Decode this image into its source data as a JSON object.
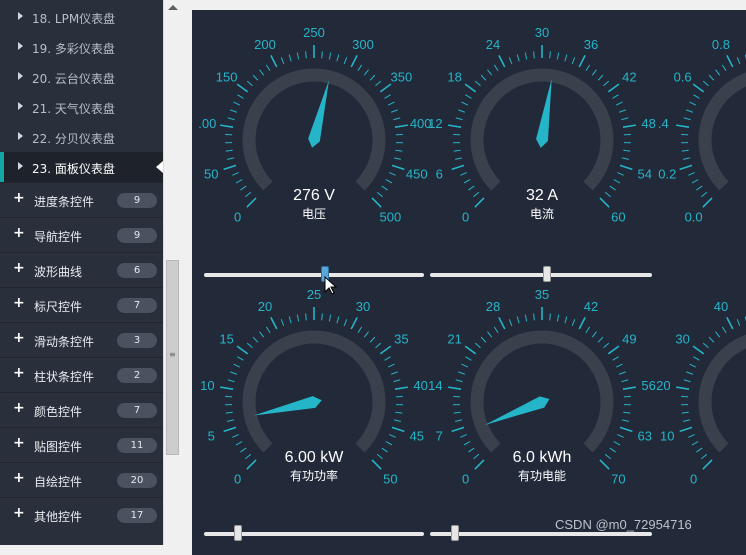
{
  "sidebar": {
    "sub_items": [
      {
        "label": "18. LPM仪表盘"
      },
      {
        "label": "19. 多彩仪表盘"
      },
      {
        "label": "20. 云台仪表盘"
      },
      {
        "label": "21. 天气仪表盘"
      },
      {
        "label": "22. 分贝仪表盘"
      },
      {
        "label": "23. 面板仪表盘",
        "active": true
      }
    ],
    "groups": [
      {
        "label": "进度条控件",
        "count": "9"
      },
      {
        "label": "导航控件",
        "count": "9"
      },
      {
        "label": "波形曲线",
        "count": "6"
      },
      {
        "label": "标尺控件",
        "count": "7"
      },
      {
        "label": "滑动条控件",
        "count": "3"
      },
      {
        "label": "柱状条控件",
        "count": "2"
      },
      {
        "label": "颜色控件",
        "count": "7"
      },
      {
        "label": "贴图控件",
        "count": "11"
      },
      {
        "label": "自绘控件",
        "count": "20"
      },
      {
        "label": "其他控件",
        "count": "17"
      }
    ]
  },
  "colors": {
    "accent": "#17a6a6",
    "gauge_cyan": "#25b5c8",
    "panel_bg": "#222939",
    "gauge_track": "#3a404c"
  },
  "gauges": [
    {
      "value_text": "276 V",
      "label": "电压",
      "min": 0,
      "max": 500,
      "value": 276,
      "ticks": [
        "0",
        "50",
        ".00",
        "150",
        "200",
        "250",
        "300",
        "350",
        "400",
        "450",
        "500"
      ]
    },
    {
      "value_text": "32 A",
      "label": "电流",
      "min": 0,
      "max": 60,
      "value": 32,
      "ticks": [
        "0",
        "6",
        "12",
        "18",
        "24",
        "30",
        "36",
        "42",
        "48",
        "54",
        "60"
      ]
    },
    {
      "value_text": "",
      "label": "",
      "min": 0,
      "max": 1,
      "value": 0.5,
      "ticks": [
        "0.0",
        "0.2",
        ".4",
        "0.6",
        "0.8"
      ]
    },
    {
      "value_text": "6.00 kW",
      "label": "有功功率",
      "min": 0,
      "max": 50,
      "value": 6,
      "ticks": [
        "0",
        "5",
        "10",
        "15",
        "20",
        "25",
        "30",
        "35",
        "40",
        "45",
        "50"
      ]
    },
    {
      "value_text": "6.0 kWh",
      "label": "有功电能",
      "min": 0,
      "max": 70,
      "value": 6,
      "ticks": [
        "0",
        "7",
        "14",
        "21",
        "28",
        "35",
        "42",
        "49",
        "56",
        "63",
        "70"
      ]
    },
    {
      "value_text": "",
      "label": "",
      "min": 0,
      "max": 100,
      "value": 50,
      "ticks": [
        "0",
        "10",
        "20",
        "30",
        "40"
      ]
    }
  ],
  "sliders": [
    {
      "value": 0.55,
      "active": true
    },
    {
      "value": 0.53,
      "active": false
    },
    {
      "value": 0.14,
      "active": false
    },
    {
      "value": 0.1,
      "active": false
    }
  ],
  "watermark": "CSDN @m0_72954716"
}
